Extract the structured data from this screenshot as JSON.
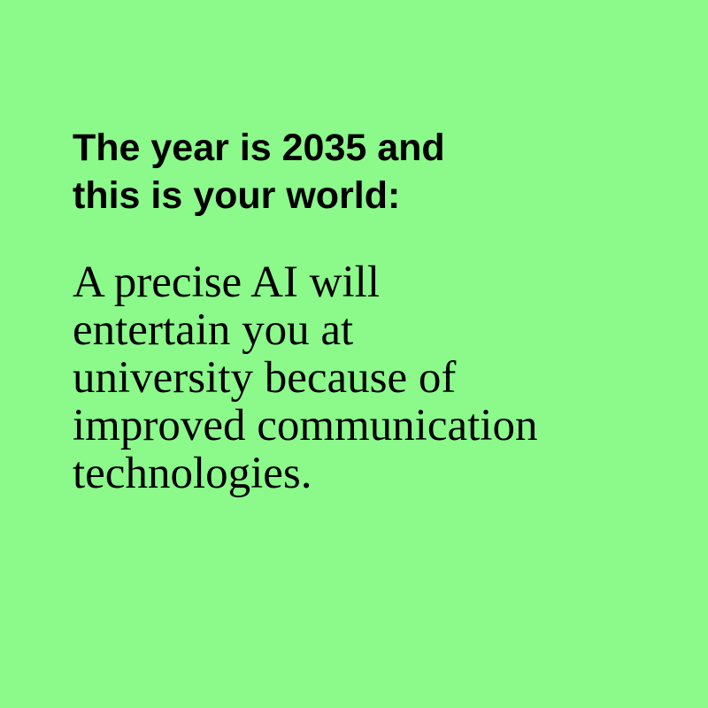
{
  "colors": {
    "background": "#8bfa8b",
    "text": "#000000"
  },
  "headline": {
    "lines": [
      "The year is 2035 and",
      "this is your world:"
    ]
  },
  "body": {
    "lines": [
      "A precise AI will",
      "entertain you at",
      "university because of",
      "improved communication",
      "technologies."
    ]
  }
}
